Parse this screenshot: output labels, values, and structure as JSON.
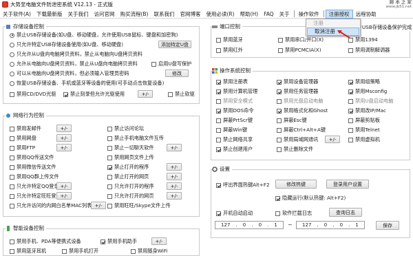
{
  "title": "大势至电脑文件防泄密系统 V12.13 - 正式版",
  "watermark": {
    "line1": "脚 本 之 家",
    "line2": "www.jb51.net"
  },
  "menu": [
    "关于软件(A)",
    "下载最新版",
    "关于我们",
    "访问官网",
    "购买流程(B)",
    "联系我们",
    "官网博客",
    "使用必读(R)",
    "帮助(H)",
    "FAQ",
    "关于",
    "操作软件",
    "注册授权",
    "远程协助"
  ],
  "dropdown": {
    "items": [
      "注册",
      "取消注册"
    ]
  },
  "storage": {
    "title": "存储设备控制",
    "r1": "禁止USB存储设备(如U盘、移动硬盘，允许使用USB鼠标、键盘和加密狗)",
    "r2": "只允许特定USB存储设备使用(如U盘、移动硬盘)",
    "r2btn": "添加特定U盘",
    "r3": "只允许从U盘向电脑拷贝资料，禁止从电脑向U盘拷贝资料",
    "r4": "允许从电脑向U盘拷贝资料，禁止从U盘向电脑拷贝资料",
    "r4cb": "启用U盘写保护",
    "r5": "可以从电脑向U盘拷贝资料，但必须输入管理员密码",
    "r5btn": "修改",
    "r6": "恢复USB存储设备、手机或蓝牙等设备的使用(可手动点击恢复设备)",
    "c1": "禁用CD/DVD光驱",
    "c2": "禁止刻录但允许光驱使用",
    "c2btn": "+/-",
    "c3": "禁止软驱"
  },
  "net": {
    "title": "网络行为控制",
    "left": [
      "禁用发邮件",
      "禁用网盘",
      "禁用FTP",
      "禁用QQ传送文件",
      "禁用微信传送文件",
      "禁用QQ群上传文件",
      "只允许特定QQ登录",
      "只允许特定旺旺登录",
      "只允许访问的内网白名单MAC列表"
    ],
    "right": [
      "禁止访问论坛",
      "禁止手机电脑文件互传",
      "禁止一切聊天软件",
      "禁用网页文件上传",
      "禁止打开的程序",
      "禁止打开的网页",
      "只允许打开的程序",
      "只允许打开的网页",
      "禁用旺旺/Skype文件上传"
    ],
    "btn": "+/-"
  },
  "smart": {
    "title": "智能设备控制",
    "items": [
      "禁用手机、PDA等便携式设备",
      "禁用手机助手",
      "禁用蓝牙耳机",
      "禁用手机打开",
      "禁用随身WiFi"
    ],
    "btn": "+/-"
  },
  "port": {
    "title": "端口控制",
    "tag": "USB存储设备保护完成",
    "items": [
      "禁用蓝牙",
      "禁用串口/并口(X)",
      "禁用1394",
      "禁用红外",
      "禁用PCMCIA(X)",
      "禁用调制解调器"
    ]
  },
  "ops": {
    "title": "操作系统控制",
    "rows": [
      [
        "禁用注册表",
        "禁用设备管理器",
        "禁用组策略"
      ],
      [
        "禁用计算机管理",
        "禁用任务管理器",
        "禁用Msconfig"
      ],
      [
        "禁用安全模式",
        "禁用光盘启动电脑",
        "禁用U盘启动电脑"
      ],
      [
        "禁用DOS命令",
        "禁用格式化和Ghost",
        "禁用改IP/Mac"
      ],
      [
        "屏蔽PrtScr键",
        "屏蔽Esc键",
        "屏蔽剪贴板"
      ],
      [
        "屏蔽Win键",
        "屏蔽Ctrl+Alt+A键",
        "禁用Telnet"
      ],
      [
        "禁止网络共享",
        "禁用局域网通讯",
        "禁用虚拟机"
      ],
      [
        "禁止创建用户",
        "禁止删除文件",
        ""
      ]
    ],
    "netbtn": "+/-"
  },
  "settings": {
    "title": "设置",
    "hotkey": "呼出界面热键Alt+F2",
    "modify": "修改热键",
    "users": "登录用户设置",
    "hide": "隐藏运行(默认热键: Alt+F2)",
    "autorun": "开机自动启动",
    "log": "软件拦截日志",
    "querylog": "查询日志",
    "ip_from": [
      "127",
      "0",
      "0",
      "1"
    ],
    "ip_to": [
      "127",
      "0",
      "0",
      "1"
    ],
    "save": "保存"
  }
}
